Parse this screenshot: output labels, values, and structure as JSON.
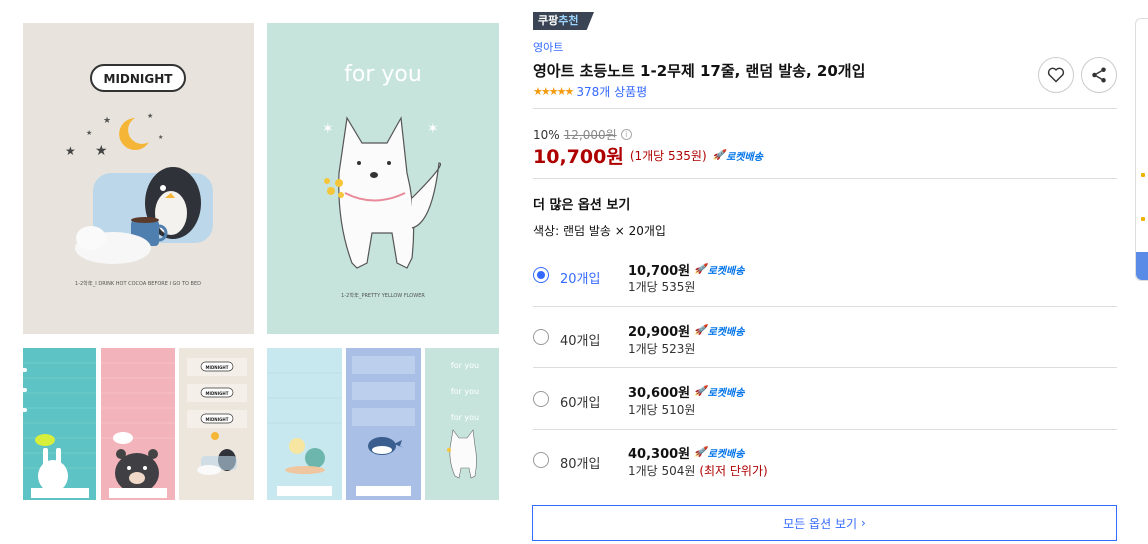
{
  "gallery": {
    "cover1": {
      "label": "MIDNIGHT",
      "caption": "1-2학年_I DRINK HOT COCOA BEFORE I GO TO BED"
    },
    "cover2": {
      "label": "for you",
      "caption": "1-2학年_PRETTY YELLOW FLOWER"
    },
    "thumb_labels": {
      "t3": "MIDNIGHT",
      "t6": "for you"
    }
  },
  "badge": {
    "part1": "쿠팡",
    "part2": "추천"
  },
  "product": {
    "brand": "영아트",
    "title": "영아트 초등노트 1-2무제 17줄, 랜덤 발송, 20개입",
    "stars": "★★★★★",
    "reviews": "378개 상품평"
  },
  "pricing": {
    "discount": "10%",
    "original": "12,000원",
    "price": "10,700원",
    "unit": "(1개당 535원)",
    "delivery": "로켓배송"
  },
  "options_section": {
    "title": "더 많은 옵션 보기",
    "color_line": "색상: 랜덤 발송 × 20개입"
  },
  "options": [
    {
      "label": "20개입",
      "price": "10,700원",
      "unit": "1개당 535원",
      "note": "",
      "selected": true
    },
    {
      "label": "40개입",
      "price": "20,900원",
      "unit": "1개당 523원",
      "note": "",
      "selected": false
    },
    {
      "label": "60개입",
      "price": "30,600원",
      "unit": "1개당 510원",
      "note": "",
      "selected": false
    },
    {
      "label": "80개입",
      "price": "40,300원",
      "unit": "1개당 504원",
      "note": "(최저 단위가)",
      "selected": false
    }
  ],
  "all_options_button": "모든 옵션 보기",
  "colors": {
    "accent": "#346aff",
    "price": "#ae0000",
    "rocket": "#0073e9"
  }
}
